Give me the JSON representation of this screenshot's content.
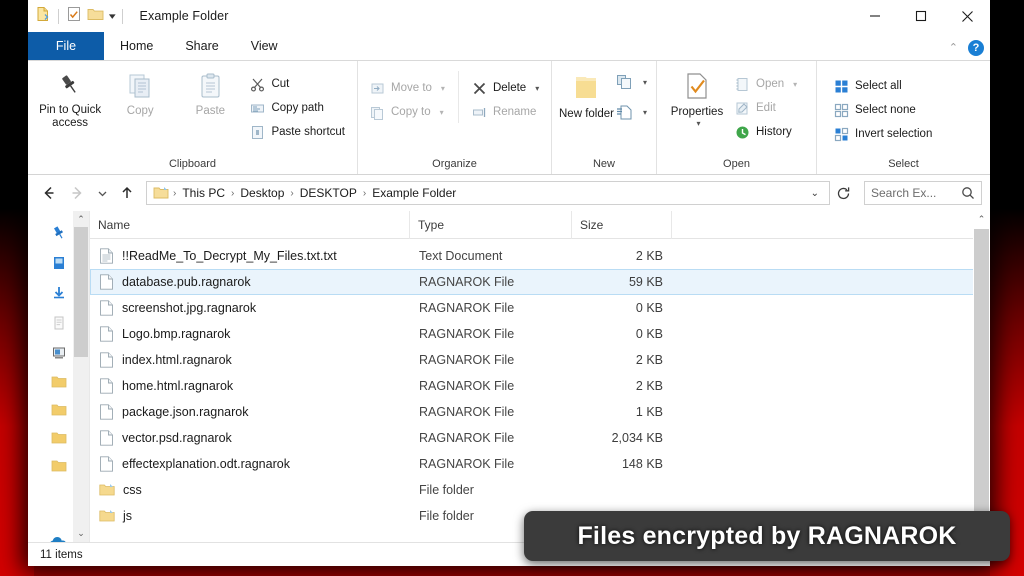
{
  "window": {
    "title": "Example Folder",
    "quick_access": [
      "new-document-icon",
      "properties-icon",
      "new-folder-icon",
      "customize-chevron-icon"
    ],
    "controls": {
      "minimize": "minimize-icon",
      "maximize": "maximize-icon",
      "close": "close-icon"
    }
  },
  "tabs": [
    {
      "label": "File",
      "active": true
    },
    {
      "label": "Home",
      "active": false
    },
    {
      "label": "Share",
      "active": false
    },
    {
      "label": "View",
      "active": false
    }
  ],
  "tab_right": {
    "collapse": "chevron-up-icon",
    "help": "?"
  },
  "ribbon": {
    "groups": [
      {
        "label": "Clipboard",
        "big": [
          {
            "label": "Pin to Quick access",
            "icon": "pin-icon",
            "disabled": false
          },
          {
            "label": "Copy",
            "icon": "copy-icon",
            "disabled": true
          },
          {
            "label": "Paste",
            "icon": "paste-icon",
            "disabled": true
          }
        ],
        "small": [
          {
            "label": "Cut",
            "icon": "scissors-icon",
            "disabled": false
          },
          {
            "label": "Copy path",
            "icon": "copy-path-icon",
            "disabled": false
          },
          {
            "label": "Paste shortcut",
            "icon": "paste-shortcut-icon",
            "disabled": false
          }
        ]
      },
      {
        "label": "Organize",
        "small": [
          {
            "label": "Move to",
            "icon": "move-to-icon",
            "caret": true,
            "disabled": true
          },
          {
            "label": "Copy to",
            "icon": "copy-to-icon",
            "caret": true,
            "disabled": true
          }
        ],
        "small2": [
          {
            "label": "Delete",
            "icon": "delete-x-icon",
            "caret": true,
            "disabled": false
          },
          {
            "label": "Rename",
            "icon": "rename-icon",
            "caret": false,
            "disabled": true
          }
        ]
      },
      {
        "label": "New",
        "big": [
          {
            "label": "New folder",
            "icon": "new-folder-icon",
            "disabled": false
          }
        ],
        "mini": [
          {
            "icon": "new-item-icon",
            "caret": true
          },
          {
            "icon": "easy-access-icon",
            "caret": true
          }
        ]
      },
      {
        "label": "Open",
        "big": [
          {
            "label": "Properties",
            "icon": "properties-icon",
            "caret": true,
            "disabled": false
          }
        ],
        "small": [
          {
            "label": "Open",
            "icon": "open-icon",
            "caret": true,
            "disabled": true
          },
          {
            "label": "Edit",
            "icon": "edit-icon",
            "caret": false,
            "disabled": true
          },
          {
            "label": "History",
            "icon": "history-icon",
            "caret": false,
            "disabled": false
          }
        ]
      },
      {
        "label": "Select",
        "small": [
          {
            "label": "Select all",
            "icon": "select-all-icon",
            "disabled": false
          },
          {
            "label": "Select none",
            "icon": "select-none-icon",
            "disabled": false
          },
          {
            "label": "Invert selection",
            "icon": "invert-selection-icon",
            "disabled": false
          }
        ]
      }
    ]
  },
  "addressbar": {
    "back": "back-arrow-icon",
    "forward": "forward-arrow-icon",
    "recent": "chevron-down-icon",
    "up": "up-arrow-icon",
    "path_icon": "folder-icon",
    "breadcrumbs": [
      "This PC",
      "Desktop",
      "DESKTOP",
      "Example Folder"
    ],
    "separator": "›",
    "dropdown": "chevron-down-icon",
    "refresh": "refresh-icon",
    "search_placeholder": "Search Ex...",
    "search_value": "",
    "search_icon": "search-icon"
  },
  "navpane": {
    "scroll_up": "chevron-up-icon",
    "scroll_down": "chevron-down-icon",
    "items": [
      {
        "icon": "quick-access-pin-icon",
        "color": "#2a7fd4"
      },
      {
        "icon": "onedrive-blue-icon",
        "color": "#1f7ec4"
      },
      {
        "icon": "downloads-icon",
        "color": "#2a7fd4"
      },
      {
        "icon": "documents-icon",
        "color": "#c9c9c9"
      },
      {
        "icon": "this-pc-icon",
        "color": "#4a4a4a"
      },
      {
        "icon": "folder-icon",
        "color": "#f2cc6a"
      },
      {
        "icon": "folder-icon",
        "color": "#f2cc6a"
      },
      {
        "icon": "folder-icon",
        "color": "#f2cc6a"
      },
      {
        "icon": "folder-icon",
        "color": "#f2cc6a"
      },
      {
        "icon": "onedrive-cloud-icon",
        "color": "#1f7ec4"
      }
    ]
  },
  "filelist": {
    "columns": [
      "Name",
      "Type",
      "Size"
    ],
    "rows": [
      {
        "name": "!!ReadMe_To_Decrypt_My_Files.txt.txt",
        "type": "Text Document",
        "size": "2 KB",
        "icon": "text-document-icon",
        "selected": false
      },
      {
        "name": "database.pub.ragnarok",
        "type": "RAGNAROK File",
        "size": "59 KB",
        "icon": "blank-file-icon",
        "selected": true
      },
      {
        "name": "screenshot.jpg.ragnarok",
        "type": "RAGNAROK File",
        "size": "0 KB",
        "icon": "blank-file-icon",
        "selected": false
      },
      {
        "name": "Logo.bmp.ragnarok",
        "type": "RAGNAROK File",
        "size": "0 KB",
        "icon": "blank-file-icon",
        "selected": false
      },
      {
        "name": "index.html.ragnarok",
        "type": "RAGNAROK File",
        "size": "2 KB",
        "icon": "blank-file-icon",
        "selected": false
      },
      {
        "name": "home.html.ragnarok",
        "type": "RAGNAROK File",
        "size": "2 KB",
        "icon": "blank-file-icon",
        "selected": false
      },
      {
        "name": "package.json.ragnarok",
        "type": "RAGNAROK File",
        "size": "1 KB",
        "icon": "blank-file-icon",
        "selected": false
      },
      {
        "name": "vector.psd.ragnarok",
        "type": "RAGNAROK File",
        "size": "2,034 KB",
        "icon": "blank-file-icon",
        "selected": false
      },
      {
        "name": "effectexplanation.odt.ragnarok",
        "type": "RAGNAROK File",
        "size": "148 KB",
        "icon": "blank-file-icon",
        "selected": false
      },
      {
        "name": "css",
        "type": "File folder",
        "size": "",
        "icon": "folder-icon",
        "selected": false
      },
      {
        "name": "js",
        "type": "File folder",
        "size": "",
        "icon": "folder-icon",
        "selected": false
      }
    ]
  },
  "statusbar": {
    "item_count": "11 items"
  },
  "banner": {
    "text": "Files encrypted by RAGNAROK"
  },
  "colors": {
    "accent_blue": "#0d5ca8",
    "selection_bg": "#eaf4fc",
    "selection_border": "#b9dcf4",
    "folder_yellow": "#f2cc6a",
    "backdrop_red": "#c40000",
    "banner_bg": "#3b3b3b"
  }
}
